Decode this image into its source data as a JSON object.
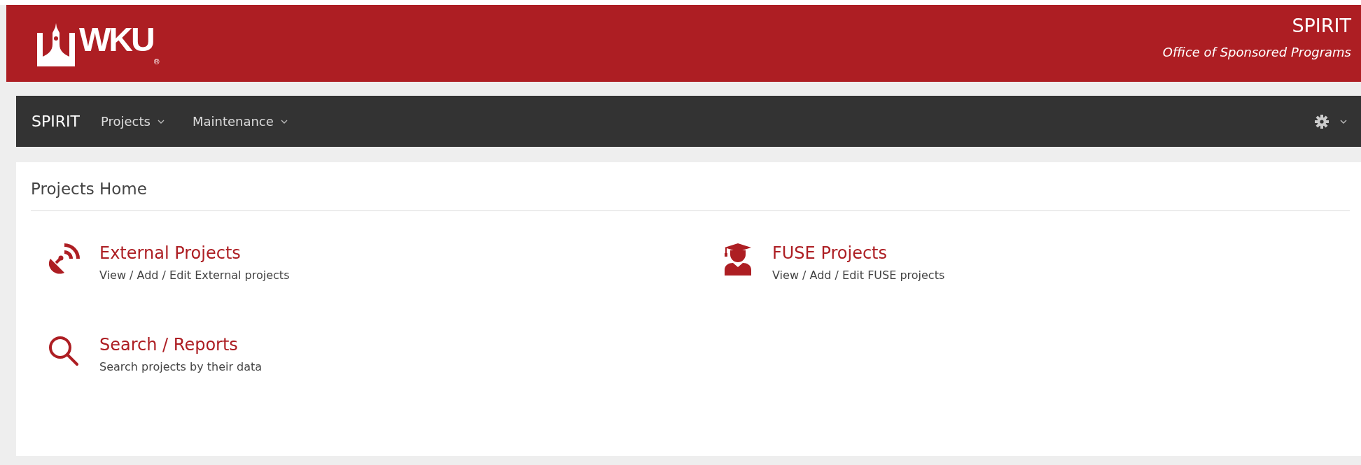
{
  "header": {
    "logo_text": "WKU",
    "logo_mark": "®",
    "title": "SPIRIT",
    "subtitle": "Office of Sponsored Programs"
  },
  "navbar": {
    "brand": "SPIRIT",
    "menus": [
      {
        "label": "Projects"
      },
      {
        "label": "Maintenance"
      }
    ]
  },
  "page": {
    "title": "Projects Home",
    "links": [
      {
        "kind": "satellite",
        "title": "External Projects",
        "description": "View / Add / Edit External projects"
      },
      {
        "kind": "graduate",
        "title": "FUSE Projects",
        "description": "View / Add / Edit FUSE projects"
      },
      {
        "kind": "search",
        "title": "Search / Reports",
        "description": "Search projects by their data"
      }
    ]
  }
}
